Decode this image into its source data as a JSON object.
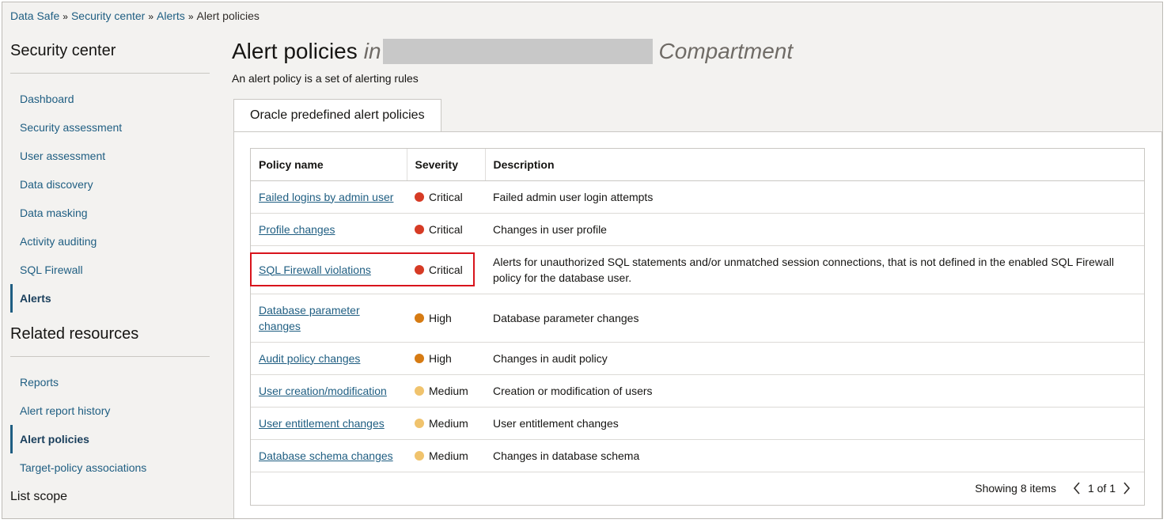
{
  "breadcrumb": {
    "items": [
      "Data Safe",
      "Security center",
      "Alerts"
    ],
    "current": "Alert policies",
    "separator": "»"
  },
  "sidebar": {
    "heading": "Security center",
    "items": [
      {
        "label": "Dashboard"
      },
      {
        "label": "Security assessment"
      },
      {
        "label": "User assessment"
      },
      {
        "label": "Data discovery"
      },
      {
        "label": "Data masking"
      },
      {
        "label": "Activity auditing"
      },
      {
        "label": "SQL Firewall"
      },
      {
        "label": "Alerts",
        "active": true
      }
    ],
    "related_heading": "Related resources",
    "related_items": [
      {
        "label": "Reports"
      },
      {
        "label": "Alert report history"
      },
      {
        "label": "Alert policies",
        "active": true
      },
      {
        "label": "Target-policy associations"
      }
    ],
    "list_scope": "List scope"
  },
  "main": {
    "title": "Alert policies",
    "title_in": "in",
    "title_compartment": "Compartment",
    "subtitle": "An alert policy is a set of alerting rules",
    "tab_label": "Oracle predefined alert policies"
  },
  "table": {
    "headers": [
      "Policy name",
      "Severity",
      "Description"
    ],
    "rows": [
      {
        "name": "Failed logins by admin user",
        "severity": "Critical",
        "description": "Failed admin user login attempts"
      },
      {
        "name": "Profile changes",
        "severity": "Critical",
        "description": "Changes in user profile"
      },
      {
        "name": "SQL Firewall violations",
        "severity": "Critical",
        "description": "Alerts for unauthorized SQL statements and/or unmatched session connections, that is not defined in the enabled SQL Firewall policy for the database user."
      },
      {
        "name": "Database parameter changes",
        "severity": "High",
        "description": "Database parameter changes"
      },
      {
        "name": "Audit policy changes",
        "severity": "High",
        "description": "Changes in audit policy"
      },
      {
        "name": "User creation/modification",
        "severity": "Medium",
        "description": "Creation or modification of users"
      },
      {
        "name": "User entitlement changes",
        "severity": "Medium",
        "description": "User entitlement changes"
      },
      {
        "name": "Database schema changes",
        "severity": "Medium",
        "description": "Changes in database schema"
      }
    ]
  },
  "severity_colors": {
    "Critical": "#d63b25",
    "High": "#d67b13",
    "Medium": "#f0c36d"
  },
  "footer": {
    "showing": "Showing 8 items",
    "pages": "1 of 1"
  }
}
